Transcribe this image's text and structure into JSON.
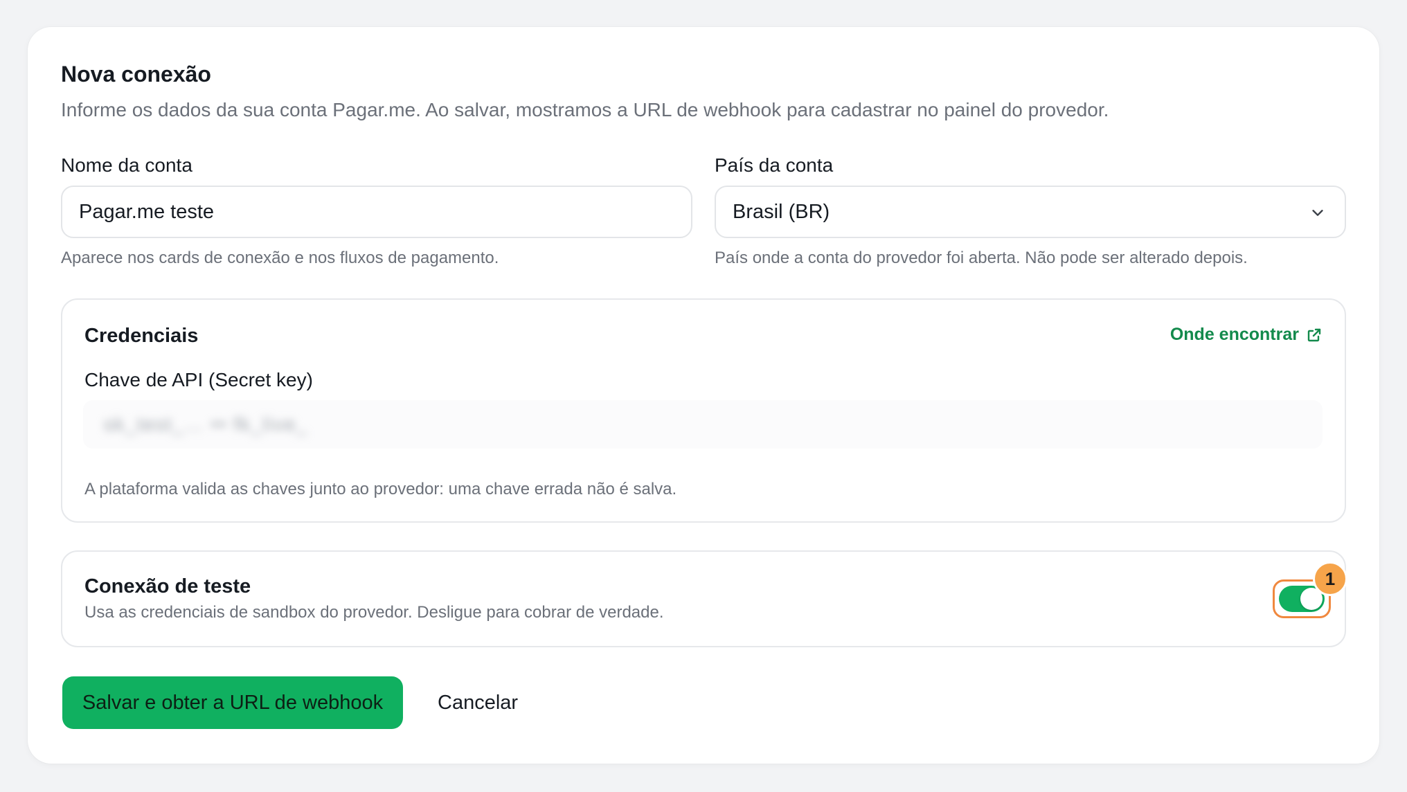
{
  "form": {
    "title": "Nova conexão",
    "subtitle": "Informe os dados da sua conta Pagar.me. Ao salvar, mostramos a URL de webhook para cadastrar no painel do provedor.",
    "account_name": {
      "label": "Nome da conta",
      "value": "Pagar.me teste",
      "hint": "Aparece nos cards de conexão e nos fluxos de pagamento."
    },
    "account_country": {
      "label": "País da conta",
      "value": "Brasil (BR)",
      "hint": "País onde a conta do provedor foi aberta. Não pode ser alterado depois."
    },
    "credentials": {
      "title": "Credenciais",
      "link_label": "Onde encontrar",
      "api_key_label": "Chave de API (Secret key)",
      "api_key_masked": "sk_test_…  ••  fk_live_",
      "hint": "A plataforma valida as chaves junto ao provedor: uma chave errada não é salva."
    },
    "test_connection": {
      "title": "Conexão de teste",
      "description": "Usa as credenciais de sandbox do provedor. Desligue para cobrar de verdade.",
      "enabled": true,
      "badge": "1"
    },
    "actions": {
      "save_label": "Salvar e obter a URL de webhook",
      "cancel_label": "Cancelar"
    }
  },
  "colors": {
    "accent": "#10b060",
    "link": "#138a4c",
    "highlight": "#f0883e",
    "badge": "#f6a44a"
  },
  "icons": {
    "select": "chevron-down-icon",
    "link": "external-link-icon"
  }
}
